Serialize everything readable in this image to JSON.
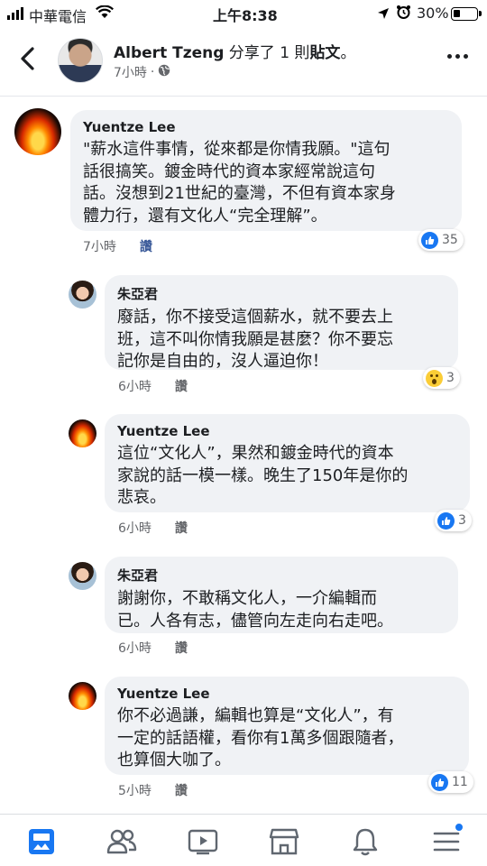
{
  "status_bar": {
    "carrier": "中華電信",
    "time": "上午8:38",
    "battery_percent": "30%",
    "battery_level": 0.3
  },
  "post_header": {
    "author": "Albert Tzeng",
    "action": " 分享了 1 則",
    "object": "貼文",
    "period": "。",
    "time": "7小時",
    "privacy_icon": "globe-icon"
  },
  "comments": [
    {
      "author": "Yuentze Lee",
      "lines": [
        "\"薪水這件事情，從來都是你情我願。\"這句",
        "話很搞笑。鍍金時代的資本家經常說這句",
        "話。沒想到21世紀的臺灣，不但有資本家身",
        "體力行，還有文化人“完全理解”。"
      ],
      "time": "7小時",
      "like_label": "讚",
      "reaction": "like",
      "reaction_count": "35"
    },
    {
      "author": "朱亞君",
      "lines": [
        "廢話，你不接受這個薪水，就不要去上",
        "班，這不叫你情我願是甚麼？你不要忘",
        "記你是自由的，沒人逼迫你！"
      ],
      "time": "6小時",
      "like_label": "讚",
      "reaction": "wow",
      "reaction_count": "3"
    },
    {
      "author": "Yuentze Lee",
      "lines": [
        "這位“文化人”，果然和鍍金時代的資本",
        "家說的話一模一樣。晚生了150年是你的",
        "悲哀。"
      ],
      "time": "6小時",
      "like_label": "讚",
      "reaction": "like",
      "reaction_count": "3"
    },
    {
      "author": "朱亞君",
      "lines": [
        "謝謝你，不敢稱文化人，一介編輯而",
        "已。人各有志，儘管向左走向右走吧。"
      ],
      "time": "6小時",
      "like_label": "讚"
    },
    {
      "author": "Yuentze Lee",
      "lines": [
        "你不必過謙，編輯也算是“文化人”，有",
        "一定的話語權，看你有1萬多個跟隨者，",
        "也算個大咖了。"
      ],
      "time": "5小時",
      "like_label": "讚",
      "reaction": "like",
      "reaction_count": "11"
    }
  ],
  "bottom_nav": [
    "news-feed-icon",
    "friends-icon",
    "watch-icon",
    "marketplace-icon",
    "notifications-icon",
    "menu-icon"
  ],
  "colors": {
    "accent": "#1877f2",
    "bubble": "#f0f2f5",
    "meta_text": "#65676b"
  }
}
